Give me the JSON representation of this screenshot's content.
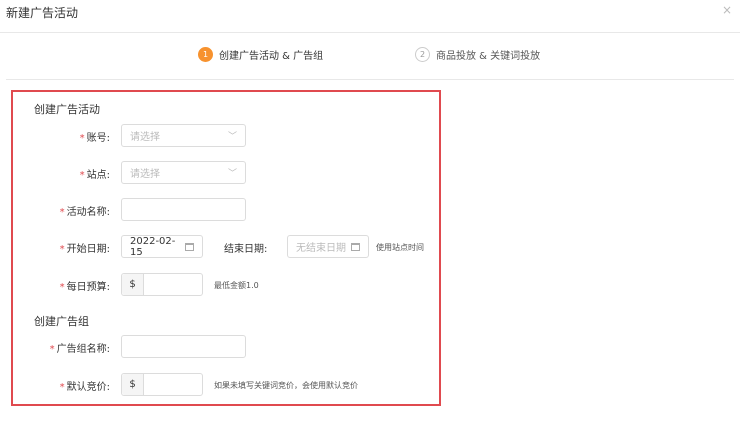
{
  "dialog": {
    "title": "新建广告活动",
    "close": "×"
  },
  "steps": [
    {
      "num": "1",
      "label": "创建广告活动 & 广告组"
    },
    {
      "num": "2",
      "label": "商品投放 & 关键词投放"
    }
  ],
  "campaign": {
    "section": "创建广告活动",
    "account": {
      "label": "账号:",
      "placeholder": "请选择"
    },
    "site": {
      "label": "站点:",
      "placeholder": "请选择"
    },
    "name": {
      "label": "活动名称:",
      "value": ""
    },
    "start": {
      "label": "开始日期:",
      "value": "2022-02-15"
    },
    "end": {
      "label": "结束日期:",
      "placeholder": "无结束日期",
      "note": "使用站点时间"
    },
    "budget": {
      "label": "每日预算:",
      "prefix": "$",
      "value": "",
      "note": "最低金额1.0"
    }
  },
  "adgroup": {
    "section": "创建广告组",
    "name": {
      "label": "广告组名称:",
      "value": ""
    },
    "bid": {
      "label": "默认竞价:",
      "prefix": "$",
      "value": "",
      "note": "如果未填写关键词竞价，会使用默认竞价"
    }
  },
  "required_mark": "*"
}
